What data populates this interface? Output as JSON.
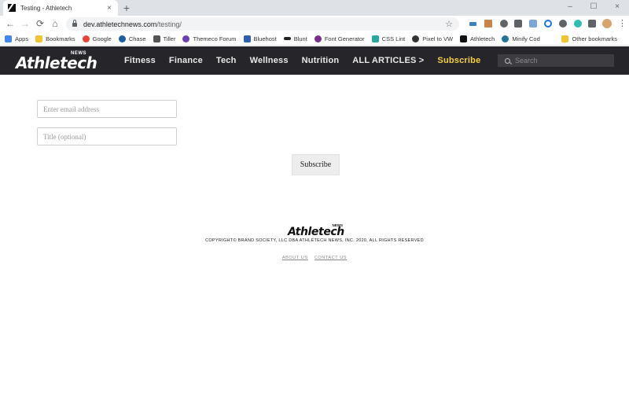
{
  "browser": {
    "tab_title": "Testing - Athletech",
    "tab_close": "×",
    "new_tab": "+",
    "window_controls": [
      "–",
      "☐",
      "×"
    ],
    "url_host": "dev.athletechnews.com",
    "url_path": "/testing/",
    "bookmarks": [
      {
        "label": "Apps",
        "color": "#4285f4"
      },
      {
        "label": "Bookmarks",
        "color": "#f4c430"
      },
      {
        "label": "Google",
        "color": "#ea4335"
      },
      {
        "label": "Chase",
        "color": "#1a5ea8"
      },
      {
        "label": "Tiller",
        "color": "#555555"
      },
      {
        "label": "Themeco Forum",
        "color": "#6a3fb5"
      },
      {
        "label": "Bluehost",
        "color": "#2f5fb3"
      },
      {
        "label": "Blunt",
        "color": "#222222"
      },
      {
        "label": "Font Generator",
        "color": "#7b2d8e"
      },
      {
        "label": "CSS Lint",
        "color": "#2aa6a0"
      },
      {
        "label": "Pixel to VW",
        "color": "#333333"
      },
      {
        "label": "Athletech",
        "color": "#111111"
      },
      {
        "label": "Minify Cod",
        "color": "#21759b"
      }
    ],
    "other_bookmarks": "Other bookmarks"
  },
  "site": {
    "logo_text": "Athletech",
    "logo_sub": "NEWS",
    "nav": [
      "Fitness",
      "Finance",
      "Tech",
      "Wellness",
      "Nutrition"
    ],
    "all_articles": "ALL ARTICLES >",
    "subscribe_nav": "Subscribe",
    "search_placeholder": "Search"
  },
  "form": {
    "email_placeholder": "Enter email address",
    "title_placeholder": "Title (optional)",
    "submit_label": "Subscribe"
  },
  "footer": {
    "logo_text": "Athletech",
    "logo_sub": "NEWS",
    "copyright": "COPYRIGHT© BRAND SOCIETY, LLC DBA ATHLETECH NEWS, INC. 2020, ALL RIGHTS RESERVED",
    "links": [
      "ABOUT US",
      "CONTACT US"
    ]
  },
  "colors": {
    "header_bg": "#26252a",
    "subscribe_accent": "#f3d13c"
  }
}
